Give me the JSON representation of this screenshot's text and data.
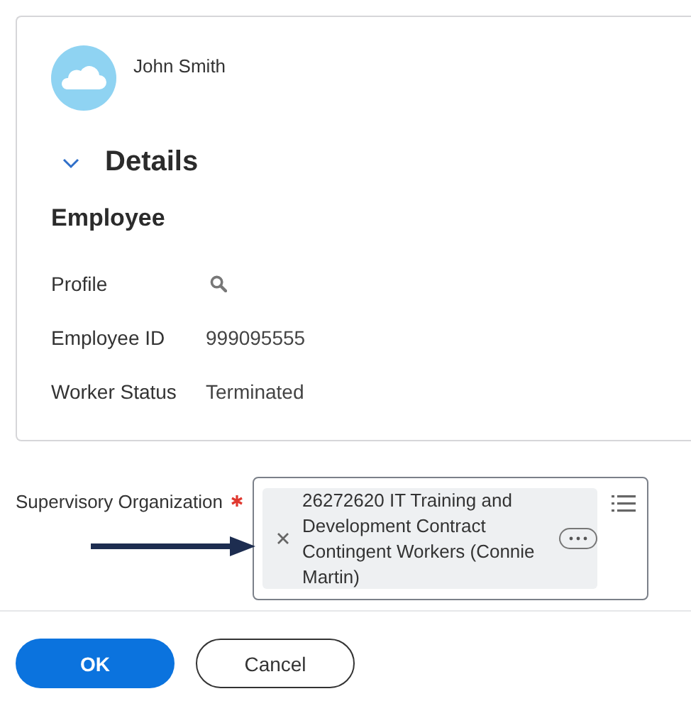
{
  "card": {
    "user_name": "John Smith",
    "section": {
      "title": "Details",
      "expanded": true
    },
    "subtitle": "Employee",
    "fields": [
      {
        "kind": "icon",
        "label": "Profile"
      },
      {
        "kind": "text",
        "label": "Employee ID",
        "value": "999095555"
      },
      {
        "kind": "text",
        "label": "Worker Status",
        "value": "Terminated"
      }
    ]
  },
  "form_field": {
    "label": "Supervisory Organization",
    "required": true,
    "selection": "26272620 IT Training and Development Contract Contingent Workers (Connie Martin)"
  },
  "buttons": [
    {
      "label": "OK",
      "kind": "primary"
    },
    {
      "label": "Cancel",
      "kind": "secondary"
    }
  ]
}
